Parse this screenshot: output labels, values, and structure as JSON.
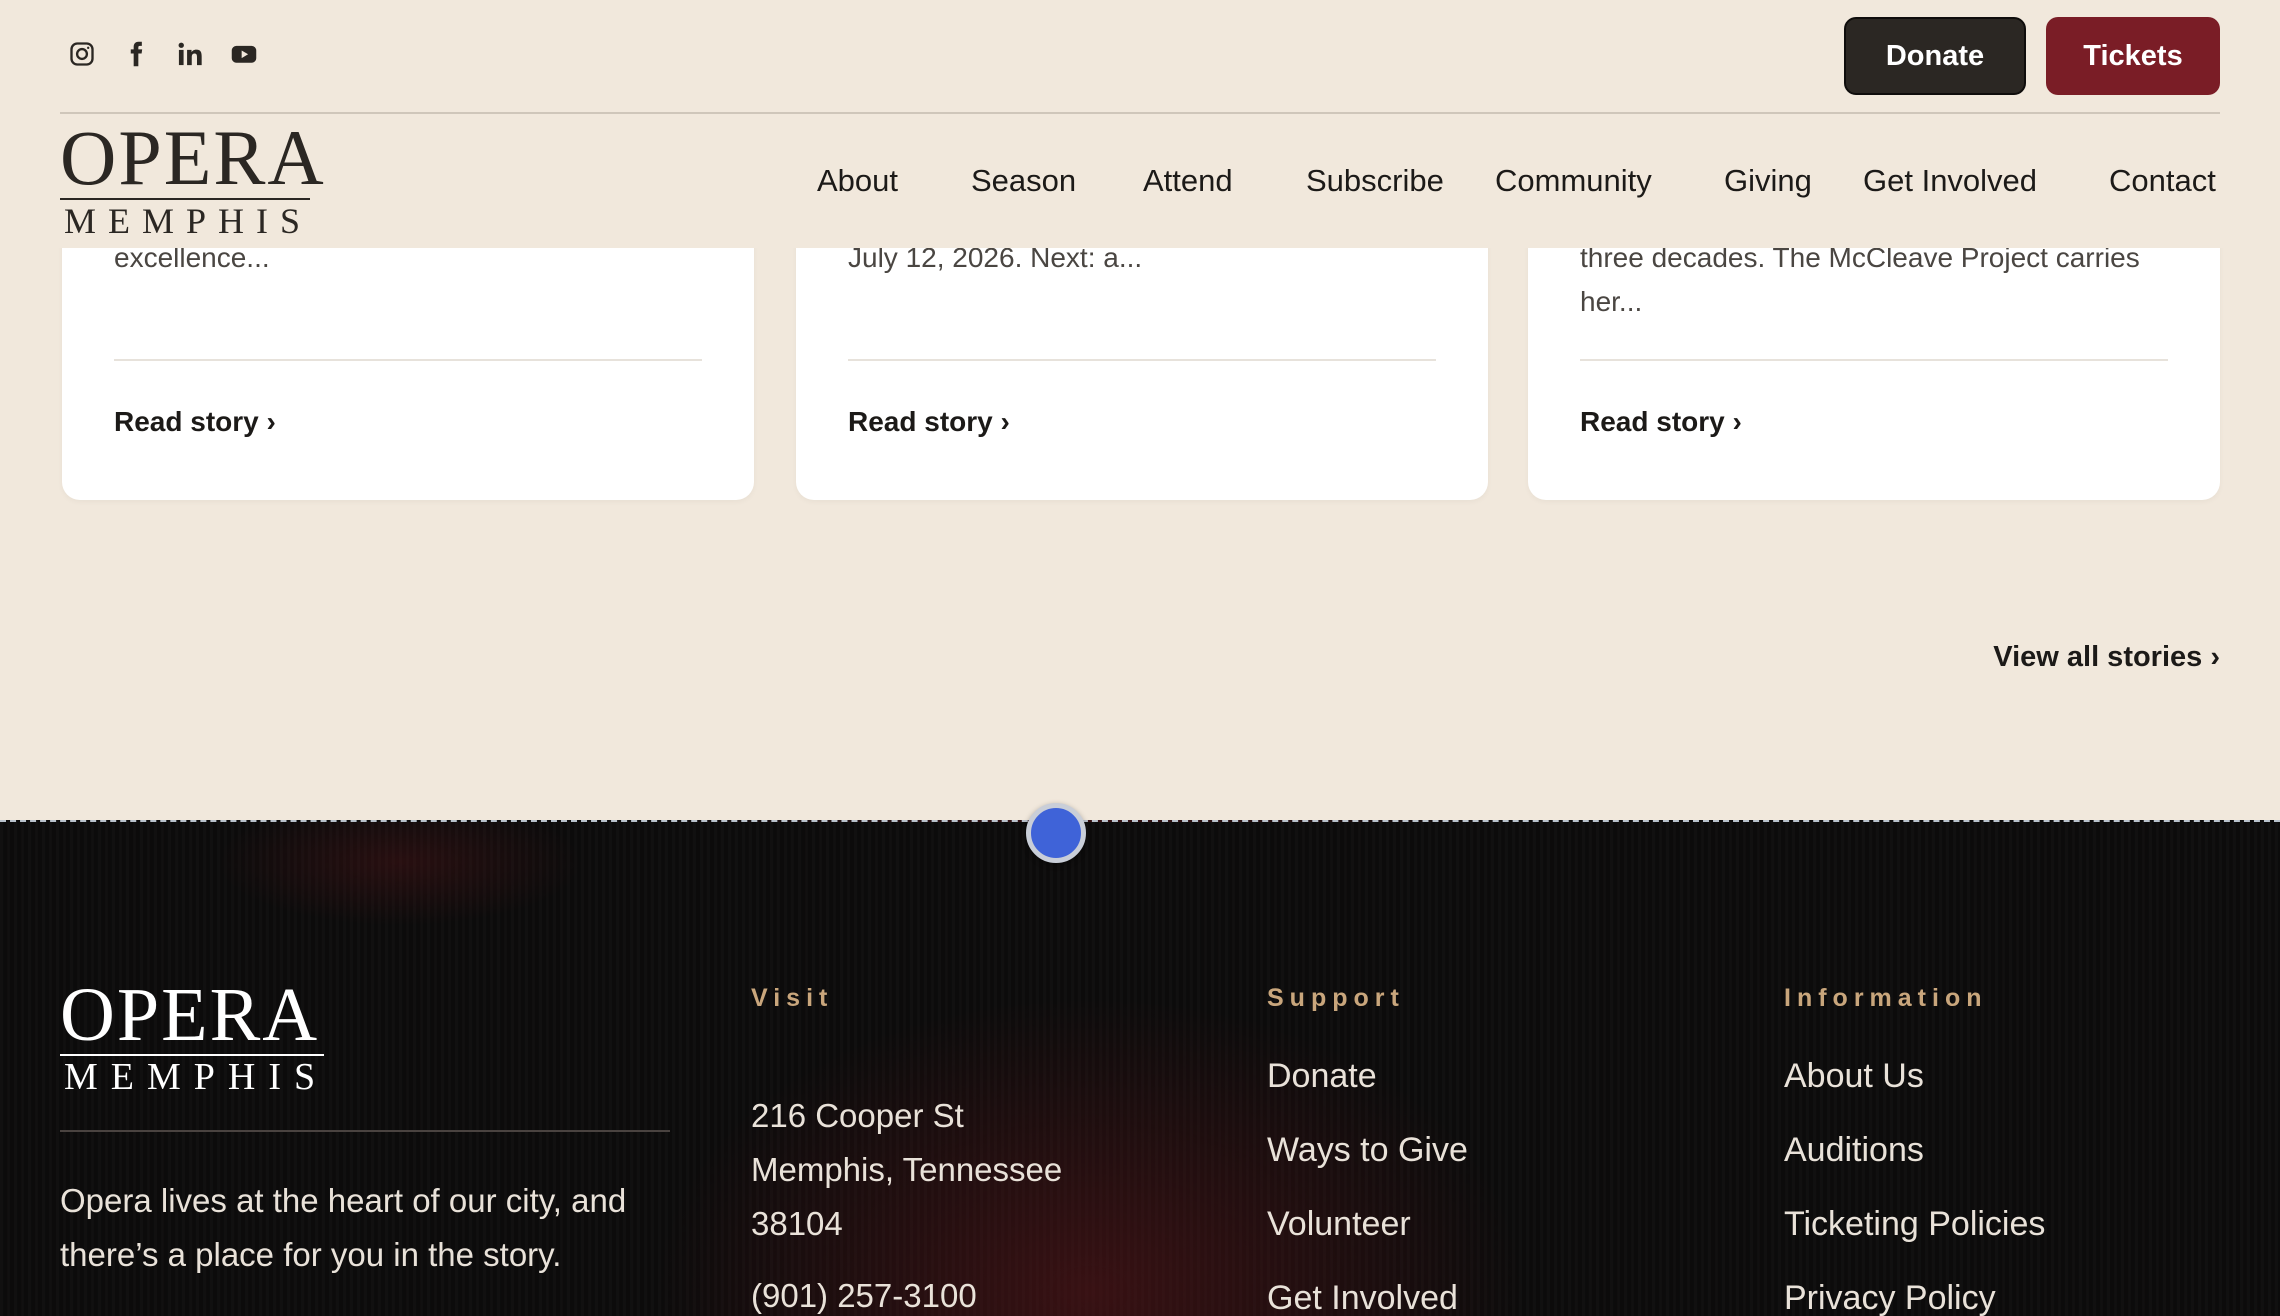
{
  "header": {
    "socials": [
      {
        "icon": "instagram-icon"
      },
      {
        "icon": "facebook-icon"
      },
      {
        "icon": "linkedin-icon"
      },
      {
        "icon": "youtube-icon"
      }
    ],
    "donate_label": "Donate",
    "tickets_label": "Tickets",
    "logo_top": "OPERA",
    "logo_bottom": "MEMPHIS",
    "nav": [
      "About",
      "Season",
      "Attend",
      "Subscribe",
      "Community",
      "Giving",
      "Get Involved",
      "Contact"
    ]
  },
  "stories": [
    {
      "excerpt": "excellence...",
      "link": "Read story ›"
    },
    {
      "excerpt": "July 12, 2026. Next: a...",
      "link": "Read story ›"
    },
    {
      "excerpt": "three decades. The McCleave Project carries her...",
      "link": "Read story ›"
    }
  ],
  "view_all": "View all stories ›",
  "footer": {
    "logo_top": "OPERA",
    "logo_bottom": "MEMPHIS",
    "tagline": "Opera lives at the heart of our city, and there’s a place for you in the story.",
    "visit": {
      "title": "Visit",
      "address_line1": "216 Cooper St",
      "address_line2": "Memphis, Tennessee",
      "address_line3": "38104",
      "phone": "(901) 257-3100"
    },
    "support": {
      "title": "Support",
      "links": [
        "Donate",
        "Ways to Give",
        "Volunteer",
        "Get Involved"
      ]
    },
    "information": {
      "title": "Information",
      "links": [
        "About Us",
        "Auditions",
        "Ticketing Policies",
        "Privacy Policy"
      ]
    }
  },
  "colors": {
    "background": "#f1e8dc",
    "accent_red": "#7a1d26",
    "button_dark": "#2b2723",
    "footer_bg": "#0c0b0b",
    "footer_heading": "#c9a67c"
  }
}
